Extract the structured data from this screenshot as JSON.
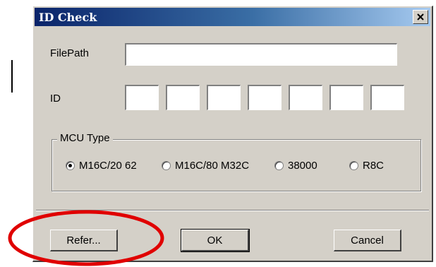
{
  "dialog": {
    "title": "ID Check",
    "close_glyph": "✕",
    "filepath": {
      "label": "FilePath",
      "value": ""
    },
    "id": {
      "label": "ID",
      "boxes": [
        "",
        "",
        "",
        "",
        "",
        "",
        ""
      ]
    },
    "mcu_type": {
      "legend": "MCU Type",
      "options": [
        "M16C/20 62",
        "M16C/80 M32C",
        "38000",
        "R8C"
      ],
      "selected_index": 0
    },
    "buttons": {
      "refer": "Refer...",
      "ok": "OK",
      "cancel": "Cancel"
    }
  },
  "annotation": {
    "color": "#e00000"
  },
  "colors": {
    "dialog_face": "#d4d0c8",
    "title_start": "#0a246a",
    "title_end": "#a6caf0"
  }
}
